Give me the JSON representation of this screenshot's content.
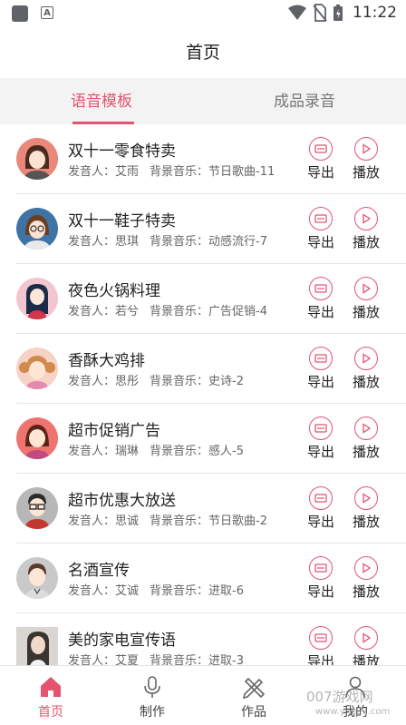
{
  "status_bar": {
    "time": "11:22"
  },
  "header": {
    "title": "首页"
  },
  "tabs": [
    {
      "label": "语音模板",
      "active": true
    },
    {
      "label": "成品录音",
      "active": false
    }
  ],
  "labels": {
    "speaker_prefix": "发音人：",
    "bgm_prefix": "背景音乐：",
    "export": "导出",
    "play": "播放"
  },
  "items": [
    {
      "title": "双十一零食特卖",
      "speaker": "艾雨",
      "bgm": "节日歌曲-11",
      "avatar": "female-avatar-1"
    },
    {
      "title": "双十一鞋子特卖",
      "speaker": "思琪",
      "bgm": "动感流行-7",
      "avatar": "female-avatar-glasses"
    },
    {
      "title": "夜色火锅料理",
      "speaker": "若兮",
      "bgm": "广告促销-4",
      "avatar": "female-avatar-longhair"
    },
    {
      "title": "香酥大鸡排",
      "speaker": "思彤",
      "bgm": "史诗-2",
      "avatar": "girl-avatar-pigtails"
    },
    {
      "title": "超市促销广告",
      "speaker": "瑞琳",
      "bgm": "感人-5",
      "avatar": "female-avatar-2"
    },
    {
      "title": "超市优惠大放送",
      "speaker": "思诚",
      "bgm": "节日歌曲-2",
      "avatar": "male-avatar-glasses"
    },
    {
      "title": "名酒宣传",
      "speaker": "艾诚",
      "bgm": "进取-6",
      "avatar": "male-avatar"
    },
    {
      "title": "美的家电宣传语",
      "speaker": "艾夏",
      "bgm": "进取-3",
      "avatar": "female-photo-avatar"
    }
  ],
  "bottom_nav": [
    {
      "label": "首页",
      "icon": "home-icon",
      "active": true
    },
    {
      "label": "制作",
      "icon": "microphone-icon",
      "active": false
    },
    {
      "label": "作品",
      "icon": "pencil-ruler-icon",
      "active": false
    },
    {
      "label": "我的",
      "icon": "user-icon",
      "active": false
    }
  ],
  "watermark": {
    "text": "007游戏网",
    "url": "www.yx007.com"
  },
  "colors": {
    "accent": "#e3546f",
    "tab_bg": "#f3f3f3",
    "divider": "#e6e6e6"
  }
}
